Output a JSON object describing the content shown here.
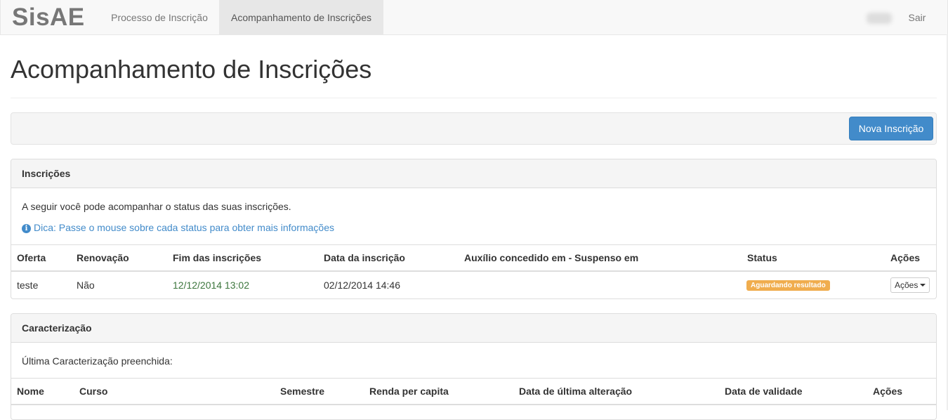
{
  "navbar": {
    "brand": "SisAE",
    "links": [
      "Processo de Inscrição",
      "Acompanhamento de Inscrições"
    ],
    "logout": "Sair"
  },
  "page": {
    "title": "Acompanhamento de Inscrições"
  },
  "toolbar": {
    "new_button": "Nova Inscrição"
  },
  "inscricoes": {
    "heading": "Inscrições",
    "intro": "A seguir você pode acompanhar o status das suas inscrições.",
    "tip": "Dica: Passe o mouse sobre cada status para obter mais informações",
    "columns": [
      "Oferta",
      "Renovação",
      "Fim das inscrições",
      "Data da inscrição",
      "Auxílio concedido em - Suspenso em",
      "Status",
      "Ações"
    ],
    "rows": [
      {
        "oferta": "teste",
        "renovacao": "Não",
        "fim": "12/12/2014 13:02",
        "data": "02/12/2014 14:46",
        "auxilio": "",
        "status": "Aguardando resultado",
        "acoes": "Ações"
      }
    ],
    "status_color": "#f0ad4e"
  },
  "caracterizacao": {
    "heading": "Caracterização",
    "intro": "Última Caracterização preenchida:",
    "columns": [
      "Nome",
      "Curso",
      "Semestre",
      "Renda per capita",
      "Data de última alteração",
      "Data de validade",
      "Ações"
    ]
  },
  "colors": {
    "primary": "#428bca",
    "success_text": "#3c763d",
    "warning": "#f0ad4e"
  }
}
